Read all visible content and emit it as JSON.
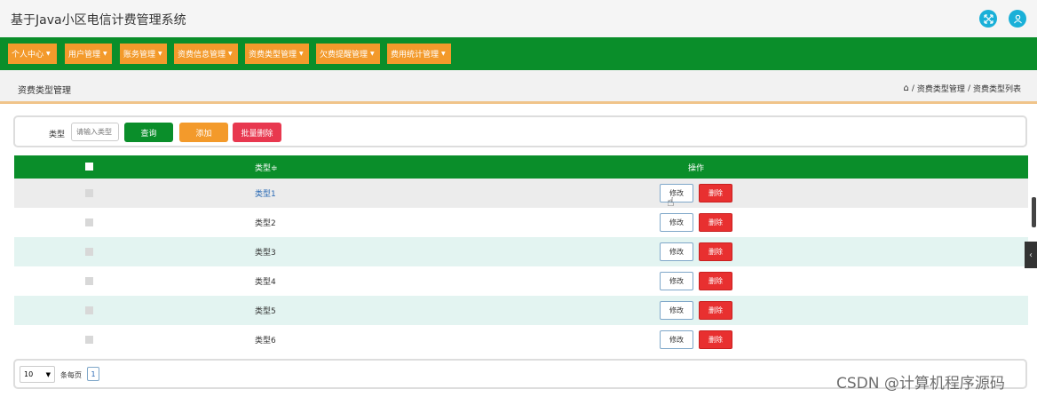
{
  "app": {
    "title": "基于Java小区电信计费管理系统"
  },
  "header_icons": [
    "expand-icon",
    "user-icon"
  ],
  "nav": {
    "items": [
      {
        "label": "个人中心"
      },
      {
        "label": "用户管理"
      },
      {
        "label": "账务管理"
      },
      {
        "label": "资费信息管理"
      },
      {
        "label": "资费类型管理"
      },
      {
        "label": "欠费提醒管理"
      },
      {
        "label": "费用统计管理"
      }
    ]
  },
  "page": {
    "title": "资费类型管理",
    "breadcrumb": {
      "level1": "资费类型管理",
      "sep": "/",
      "level2": "资费类型列表"
    }
  },
  "search": {
    "label": "类型",
    "placeholder": "请输入类型",
    "query_label": "查询",
    "add_label": "添加",
    "batch_delete_label": "批量删除"
  },
  "table": {
    "header": {
      "type_col": "类型≑",
      "actions_col": "操作"
    },
    "rows": [
      {
        "type": "类型1",
        "edit": "修改",
        "delete": "删除"
      },
      {
        "type": "类型2",
        "edit": "修改",
        "delete": "删除"
      },
      {
        "type": "类型3",
        "edit": "修改",
        "delete": "删除"
      },
      {
        "type": "类型4",
        "edit": "修改",
        "delete": "删除"
      },
      {
        "type": "类型5",
        "edit": "修改",
        "delete": "删除"
      },
      {
        "type": "类型6",
        "edit": "修改",
        "delete": "删除"
      }
    ]
  },
  "pagination": {
    "page_size": "10",
    "per_page_label": "条每页",
    "current_page": "1"
  },
  "watermark": "CSDN @计算机程序源码",
  "colors": {
    "primary_green": "#0a8e2a",
    "nav_orange": "#f39a2b",
    "delete_red": "#e83030",
    "header_icon_blue": "#1ab0d8"
  }
}
